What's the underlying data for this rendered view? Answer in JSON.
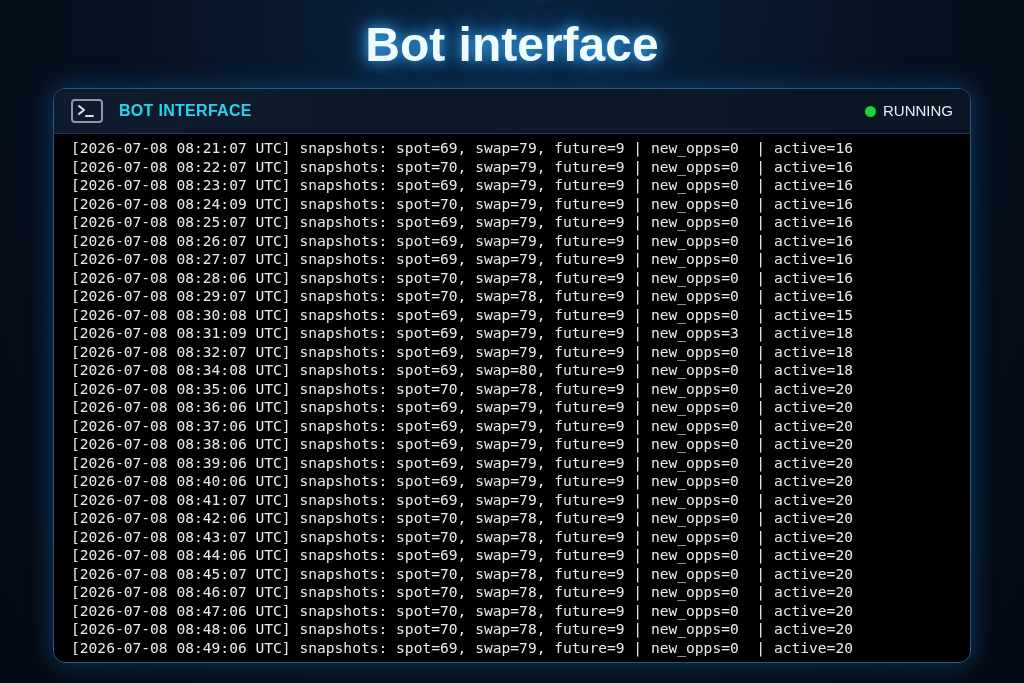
{
  "heading": "Bot interface",
  "panel": {
    "title": "BOT INTERFACE",
    "status": {
      "label": "RUNNING",
      "running": true
    }
  },
  "log_lines": [
    "[2026-07-08 08:21:07 UTC] snapshots: spot=69, swap=79, future=9 | new_opps=0  | active=16",
    "[2026-07-08 08:22:07 UTC] snapshots: spot=70, swap=79, future=9 | new_opps=0  | active=16",
    "[2026-07-08 08:23:07 UTC] snapshots: spot=69, swap=79, future=9 | new_opps=0  | active=16",
    "[2026-07-08 08:24:09 UTC] snapshots: spot=70, swap=79, future=9 | new_opps=0  | active=16",
    "[2026-07-08 08:25:07 UTC] snapshots: spot=69, swap=79, future=9 | new_opps=0  | active=16",
    "[2026-07-08 08:26:07 UTC] snapshots: spot=69, swap=79, future=9 | new_opps=0  | active=16",
    "[2026-07-08 08:27:07 UTC] snapshots: spot=69, swap=79, future=9 | new_opps=0  | active=16",
    "[2026-07-08 08:28:06 UTC] snapshots: spot=70, swap=78, future=9 | new_opps=0  | active=16",
    "[2026-07-08 08:29:07 UTC] snapshots: spot=70, swap=78, future=9 | new_opps=0  | active=16",
    "[2026-07-08 08:30:08 UTC] snapshots: spot=69, swap=79, future=9 | new_opps=0  | active=15",
    "[2026-07-08 08:31:09 UTC] snapshots: spot=69, swap=79, future=9 | new_opps=3  | active=18",
    "[2026-07-08 08:32:07 UTC] snapshots: spot=69, swap=79, future=9 | new_opps=0  | active=18",
    "[2026-07-08 08:34:08 UTC] snapshots: spot=69, swap=80, future=9 | new_opps=0  | active=18",
    "[2026-07-08 08:35:06 UTC] snapshots: spot=70, swap=78, future=9 | new_opps=0  | active=20",
    "[2026-07-08 08:36:06 UTC] snapshots: spot=69, swap=79, future=9 | new_opps=0  | active=20",
    "[2026-07-08 08:37:06 UTC] snapshots: spot=69, swap=79, future=9 | new_opps=0  | active=20",
    "[2026-07-08 08:38:06 UTC] snapshots: spot=69, swap=79, future=9 | new_opps=0  | active=20",
    "[2026-07-08 08:39:06 UTC] snapshots: spot=69, swap=79, future=9 | new_opps=0  | active=20",
    "[2026-07-08 08:40:06 UTC] snapshots: spot=69, swap=79, future=9 | new_opps=0  | active=20",
    "[2026-07-08 08:41:07 UTC] snapshots: spot=69, swap=79, future=9 | new_opps=0  | active=20",
    "[2026-07-08 08:42:06 UTC] snapshots: spot=70, swap=78, future=9 | new_opps=0  | active=20",
    "[2026-07-08 08:43:07 UTC] snapshots: spot=70, swap=78, future=9 | new_opps=0  | active=20",
    "[2026-07-08 08:44:06 UTC] snapshots: spot=69, swap=79, future=9 | new_opps=0  | active=20",
    "[2026-07-08 08:45:07 UTC] snapshots: spot=70, swap=78, future=9 | new_opps=0  | active=20",
    "[2026-07-08 08:46:07 UTC] snapshots: spot=70, swap=78, future=9 | new_opps=0  | active=20",
    "[2026-07-08 08:47:06 UTC] snapshots: spot=70, swap=78, future=9 | new_opps=0  | active=20",
    "[2026-07-08 08:48:06 UTC] snapshots: spot=70, swap=78, future=9 | new_opps=0  | active=20",
    "[2026-07-08 08:49:06 UTC] snapshots: spot=69, swap=79, future=9 | new_opps=0  | active=20"
  ]
}
